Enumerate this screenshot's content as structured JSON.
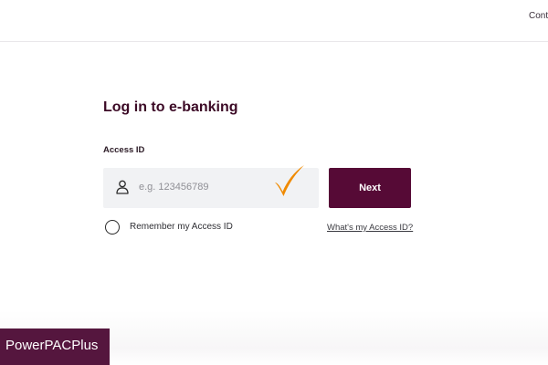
{
  "header": {
    "contact_link": "Cont"
  },
  "login": {
    "title": "Log in to e-banking",
    "access_id_label": "Access ID",
    "access_id_placeholder": "e.g. 123456789",
    "next_button": "Next",
    "remember_label": "Remember my Access ID",
    "remember_checked": false,
    "help_link": "What's my Access ID?"
  },
  "icons": {
    "user": "user-icon",
    "check": "check-mark-icon",
    "radio": "radio-unchecked-icon"
  },
  "colors": {
    "brand": "#560a36",
    "title": "#3c0a26",
    "input_background": "#f1f2f4",
    "check_mark": "#f08a00"
  },
  "watermark": {
    "text": "PowerPACPlus"
  }
}
